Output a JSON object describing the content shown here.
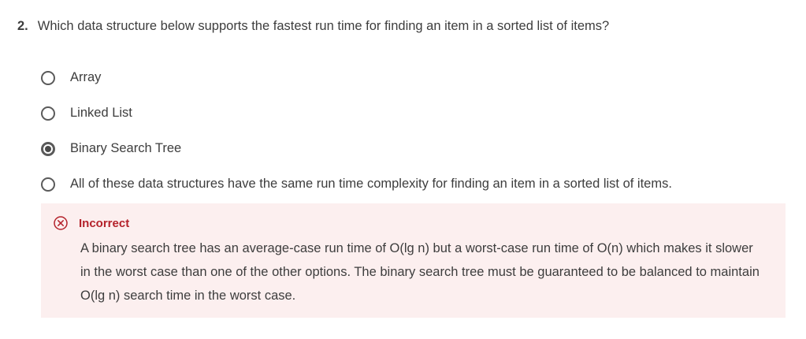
{
  "question": {
    "number": "2.",
    "text": "Which data structure below supports the fastest run time for finding an item in a sorted list of items?"
  },
  "options": [
    {
      "label": "Array",
      "selected": false
    },
    {
      "label": "Linked List",
      "selected": false
    },
    {
      "label": "Binary Search Tree",
      "selected": true
    },
    {
      "label": "All of these data structures have the same run time complexity for finding an item in a sorted list of items.",
      "selected": false
    }
  ],
  "feedback": {
    "status": "Incorrect",
    "icon": "x-circle-icon",
    "message": "A binary search tree has an average-case run time of O(lg n) but a worst-case run time of O(n) which makes it slower in the worst case than one of the other options. The binary search tree must be guaranteed to be balanced to maintain O(lg n) search time in the worst case.",
    "colors": {
      "background": "#fcefef",
      "accent": "#b4222b"
    }
  }
}
